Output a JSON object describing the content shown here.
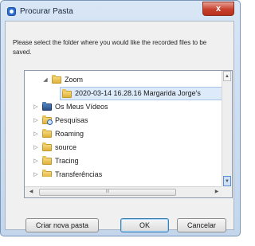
{
  "window": {
    "title": "Procurar Pasta",
    "close_symbol": "x"
  },
  "instruction": "Please select the folder where you would like the recorded files to be saved.",
  "tree": {
    "items": [
      {
        "label": "Zoom",
        "expander": "◢",
        "icon": "folder-icon",
        "selected": false
      },
      {
        "label": "2020-03-14 16.28.16 Margarida Jorge's",
        "expander": "",
        "icon": "folder-icon",
        "selected": true
      },
      {
        "label": "Os Meus Vídeos",
        "expander": "▷",
        "icon": "video-folder-icon",
        "selected": false
      },
      {
        "label": "Pesquisas",
        "expander": "▷",
        "icon": "search-folder-icon",
        "selected": false
      },
      {
        "label": "Roaming",
        "expander": "▷",
        "icon": "folder-icon",
        "selected": false
      },
      {
        "label": "source",
        "expander": "▷",
        "icon": "folder-icon",
        "selected": false
      },
      {
        "label": "Tracing",
        "expander": "▷",
        "icon": "folder-icon",
        "selected": false
      },
      {
        "label": "Transferências",
        "expander": "▷",
        "icon": "folder-icon",
        "selected": false
      }
    ]
  },
  "scrollbars": {
    "up_arrow": "▲",
    "down_arrow": "▼",
    "left_arrow": "◀",
    "right_arrow": "▶",
    "thumb_grip": "III"
  },
  "buttons": {
    "new_folder": "Criar nova pasta",
    "ok": "OK",
    "cancel": "Cancelar"
  },
  "colors": {
    "title_bar": "#c3d6ec",
    "close_button": "#c7402c",
    "selection": "#dceafa",
    "default_button_border": "#3c7fb1"
  }
}
